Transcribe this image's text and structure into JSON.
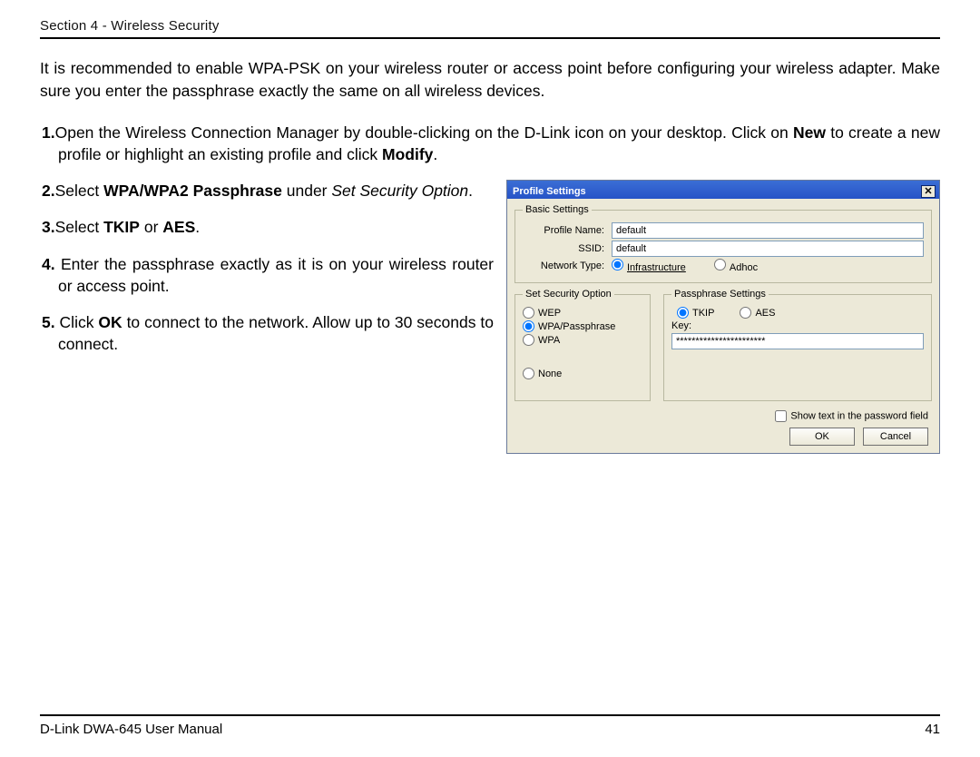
{
  "header": {
    "section": "Section 4 - Wireless Security"
  },
  "intro": "It is recommended to enable WPA-PSK on your wireless router or access point before configuring your wireless adapter. Make sure you enter the passphrase exactly the same on all wireless devices.",
  "steps": {
    "s1_a": "1.",
    "s1_b": "Open the Wireless Connection Manager by double-clicking on the D-Link icon on your desktop. Click on ",
    "s1_c": "New",
    "s1_d": " to create a new profile or highlight an existing profile and click ",
    "s1_e": "Modify",
    "s1_f": ".",
    "s2_a": "2.",
    "s2_b": "Select ",
    "s2_c": "WPA/WPA2 Passphrase",
    "s2_d": " under ",
    "s2_e": "Set Security Option",
    "s2_f": ".",
    "s3_a": "3.",
    "s3_b": "Select ",
    "s3_c": "TKIP",
    "s3_d": " or ",
    "s3_e": "AES",
    "s3_f": ".",
    "s4_a": "4.",
    "s4_b": " Enter the passphrase exactly as it is on your wireless router or access point.",
    "s5_a": "5.",
    "s5_b": " Click ",
    "s5_c": "OK",
    "s5_d": " to connect to the network. Allow up to 30 seconds to connect."
  },
  "dialog": {
    "title": "Profile Settings",
    "close": "✕",
    "basic_legend": "Basic Settings",
    "profile_name_label": "Profile Name:",
    "profile_name_value": "default",
    "ssid_label": "SSID:",
    "ssid_value": "default",
    "network_type_label": "Network Type:",
    "nt_infra": "Infrastructure",
    "nt_adhoc": "Adhoc",
    "security_legend": "Set Security Option",
    "sec_wep": "WEP",
    "sec_wpapass": "WPA/Passphrase",
    "sec_wpa": "WPA",
    "sec_none": "None",
    "pass_legend": "Passphrase Settings",
    "tkip": "TKIP",
    "aes": "AES",
    "key_label": "Key:",
    "key_value": "***********************",
    "show_text": "Show text in the password field",
    "ok": "OK",
    "cancel": "Cancel"
  },
  "footer": {
    "left": "D-Link DWA-645 User Manual",
    "right": "41"
  }
}
